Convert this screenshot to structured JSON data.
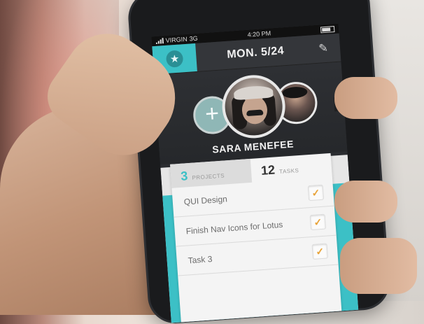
{
  "status_bar": {
    "carrier": "VIRGIN",
    "network": "3G",
    "time": "4:20 PM"
  },
  "header": {
    "date": "MON. 5/24",
    "star_icon": "star-icon",
    "edit_icon": "edit-icon"
  },
  "profile": {
    "name": "SARA MENEFEE",
    "add_symbol": "+",
    "left_arrow": "◀",
    "right_arrow": "▶"
  },
  "counts": {
    "projects_value": "3",
    "projects_label": "PROJECTS",
    "tasks_value": "12",
    "tasks_label": "TASKS"
  },
  "tasks": [
    {
      "label": "QUI Design",
      "checked": true
    },
    {
      "label": "Finish Nav Icons for Lotus",
      "checked": true
    },
    {
      "label": "Task 3",
      "checked": true
    }
  ],
  "colors": {
    "accent": "#3cc0c6",
    "check": "#e8a339",
    "bar": "#34363a"
  }
}
